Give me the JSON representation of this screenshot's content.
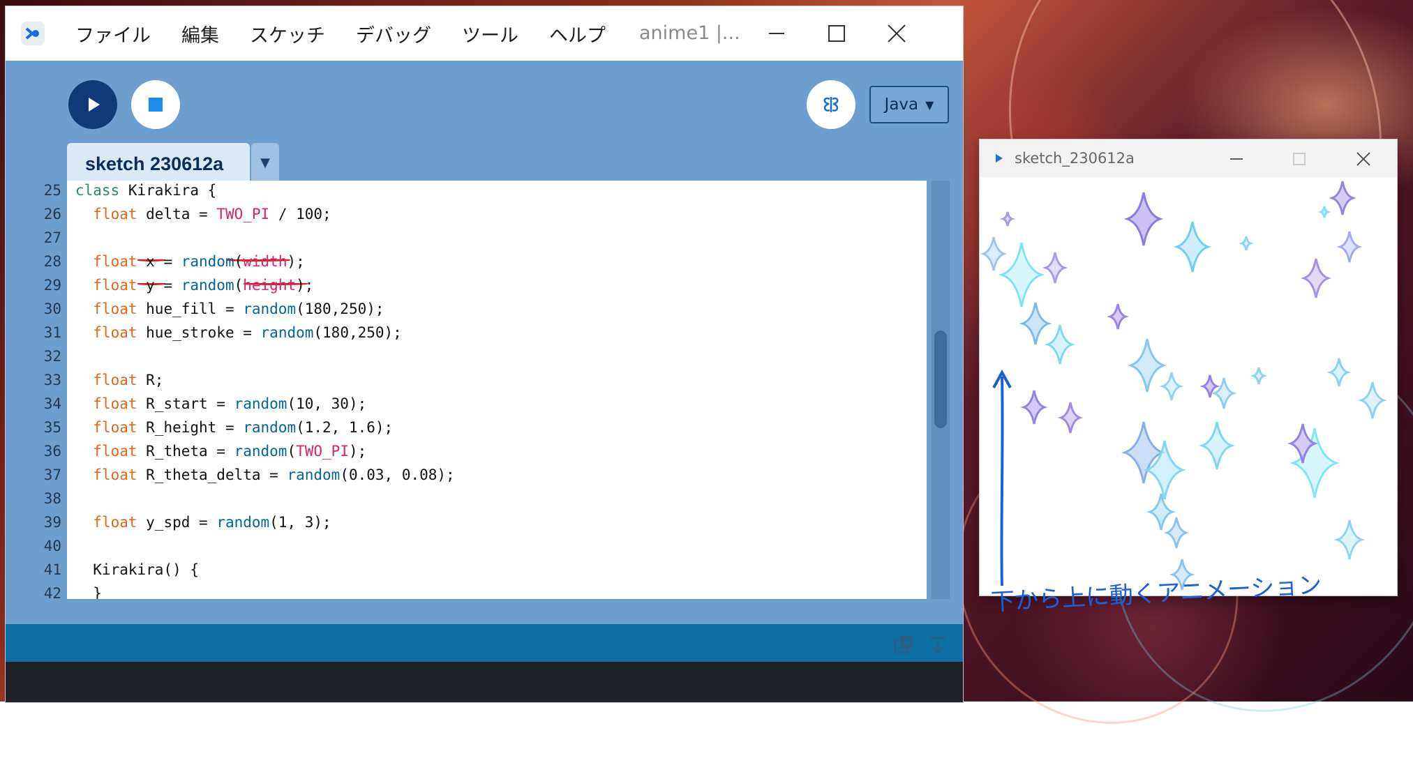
{
  "ide": {
    "menu": [
      "ファイル",
      "編集",
      "スケッチ",
      "デバッグ",
      "ツール",
      "ヘルプ"
    ],
    "window_title": "anime1 |...",
    "mode": "Java",
    "tab_name": "sketch 230612a"
  },
  "editor": {
    "lines": [
      {
        "n": "25",
        "parts": [
          {
            "t": "class",
            "c": "kw-green"
          },
          {
            "t": " Kirakira {",
            "c": ""
          }
        ]
      },
      {
        "n": "26",
        "parts": [
          {
            "t": "  ",
            "c": ""
          },
          {
            "t": "float",
            "c": "kw"
          },
          {
            "t": " delta = ",
            "c": ""
          },
          {
            "t": "TWO_PI",
            "c": "const"
          },
          {
            "t": " / 100;",
            "c": ""
          }
        ]
      },
      {
        "n": "27",
        "parts": []
      },
      {
        "n": "28",
        "parts": [
          {
            "t": "  ",
            "c": ""
          },
          {
            "t": "float",
            "c": "kw"
          },
          {
            "t": " x = ",
            "c": ""
          },
          {
            "t": "random",
            "c": "fn"
          },
          {
            "t": "(",
            "c": ""
          },
          {
            "t": "width",
            "c": "const"
          },
          {
            "t": ");",
            "c": ""
          }
        ]
      },
      {
        "n": "29",
        "parts": [
          {
            "t": "  ",
            "c": ""
          },
          {
            "t": "float",
            "c": "kw"
          },
          {
            "t": " y = ",
            "c": ""
          },
          {
            "t": "random",
            "c": "fn"
          },
          {
            "t": "(",
            "c": ""
          },
          {
            "t": "height",
            "c": "const"
          },
          {
            "t": ");",
            "c": ""
          }
        ]
      },
      {
        "n": "30",
        "parts": [
          {
            "t": "  ",
            "c": ""
          },
          {
            "t": "float",
            "c": "kw"
          },
          {
            "t": " hue_fill = ",
            "c": ""
          },
          {
            "t": "random",
            "c": "fn"
          },
          {
            "t": "(180,250);",
            "c": ""
          }
        ]
      },
      {
        "n": "31",
        "parts": [
          {
            "t": "  ",
            "c": ""
          },
          {
            "t": "float",
            "c": "kw"
          },
          {
            "t": " hue_stroke = ",
            "c": ""
          },
          {
            "t": "random",
            "c": "fn"
          },
          {
            "t": "(180,250);",
            "c": ""
          }
        ]
      },
      {
        "n": "32",
        "parts": []
      },
      {
        "n": "33",
        "parts": [
          {
            "t": "  ",
            "c": ""
          },
          {
            "t": "float",
            "c": "kw"
          },
          {
            "t": " R;",
            "c": ""
          }
        ]
      },
      {
        "n": "34",
        "parts": [
          {
            "t": "  ",
            "c": ""
          },
          {
            "t": "float",
            "c": "kw"
          },
          {
            "t": " R_start = ",
            "c": ""
          },
          {
            "t": "random",
            "c": "fn"
          },
          {
            "t": "(10, 30);",
            "c": ""
          }
        ]
      },
      {
        "n": "35",
        "parts": [
          {
            "t": "  ",
            "c": ""
          },
          {
            "t": "float",
            "c": "kw"
          },
          {
            "t": " R_height = ",
            "c": ""
          },
          {
            "t": "random",
            "c": "fn"
          },
          {
            "t": "(1.2, 1.6);",
            "c": ""
          }
        ]
      },
      {
        "n": "36",
        "parts": [
          {
            "t": "  ",
            "c": ""
          },
          {
            "t": "float",
            "c": "kw"
          },
          {
            "t": " R_theta = ",
            "c": ""
          },
          {
            "t": "random",
            "c": "fn"
          },
          {
            "t": "(",
            "c": ""
          },
          {
            "t": "TWO_PI",
            "c": "const"
          },
          {
            "t": ");",
            "c": ""
          }
        ]
      },
      {
        "n": "37",
        "parts": [
          {
            "t": "  ",
            "c": ""
          },
          {
            "t": "float",
            "c": "kw"
          },
          {
            "t": " R_theta_delta = ",
            "c": ""
          },
          {
            "t": "random",
            "c": "fn"
          },
          {
            "t": "(0.03, 0.08);",
            "c": ""
          }
        ]
      },
      {
        "n": "38",
        "parts": []
      },
      {
        "n": "39",
        "parts": [
          {
            "t": "  ",
            "c": ""
          },
          {
            "t": "float",
            "c": "kw"
          },
          {
            "t": " y_spd = ",
            "c": ""
          },
          {
            "t": "random",
            "c": "fn"
          },
          {
            "t": "(1, 3);",
            "c": ""
          }
        ]
      },
      {
        "n": "40",
        "parts": []
      },
      {
        "n": "41",
        "parts": [
          {
            "t": "  Kirakira() {",
            "c": ""
          }
        ]
      },
      {
        "n": "42",
        "parts": [
          {
            "t": "  }",
            "c": ""
          }
        ]
      }
    ]
  },
  "sketch_window": {
    "title": "sketch_230612a"
  },
  "annotation": "下から上に動くアニメーション",
  "colors": {
    "ide_bg": "#6c9fcf",
    "run_button": "#0e3b78",
    "stop_square": "#1a8cf0",
    "console_bar": "#0d6fa3",
    "keyword": "#e2661a",
    "function": "#006699",
    "constant": "#d6246e",
    "class_keyword": "#2d8a6b",
    "annotation_ink": "#1f5fd6",
    "underline_ink": "#e0192b"
  }
}
